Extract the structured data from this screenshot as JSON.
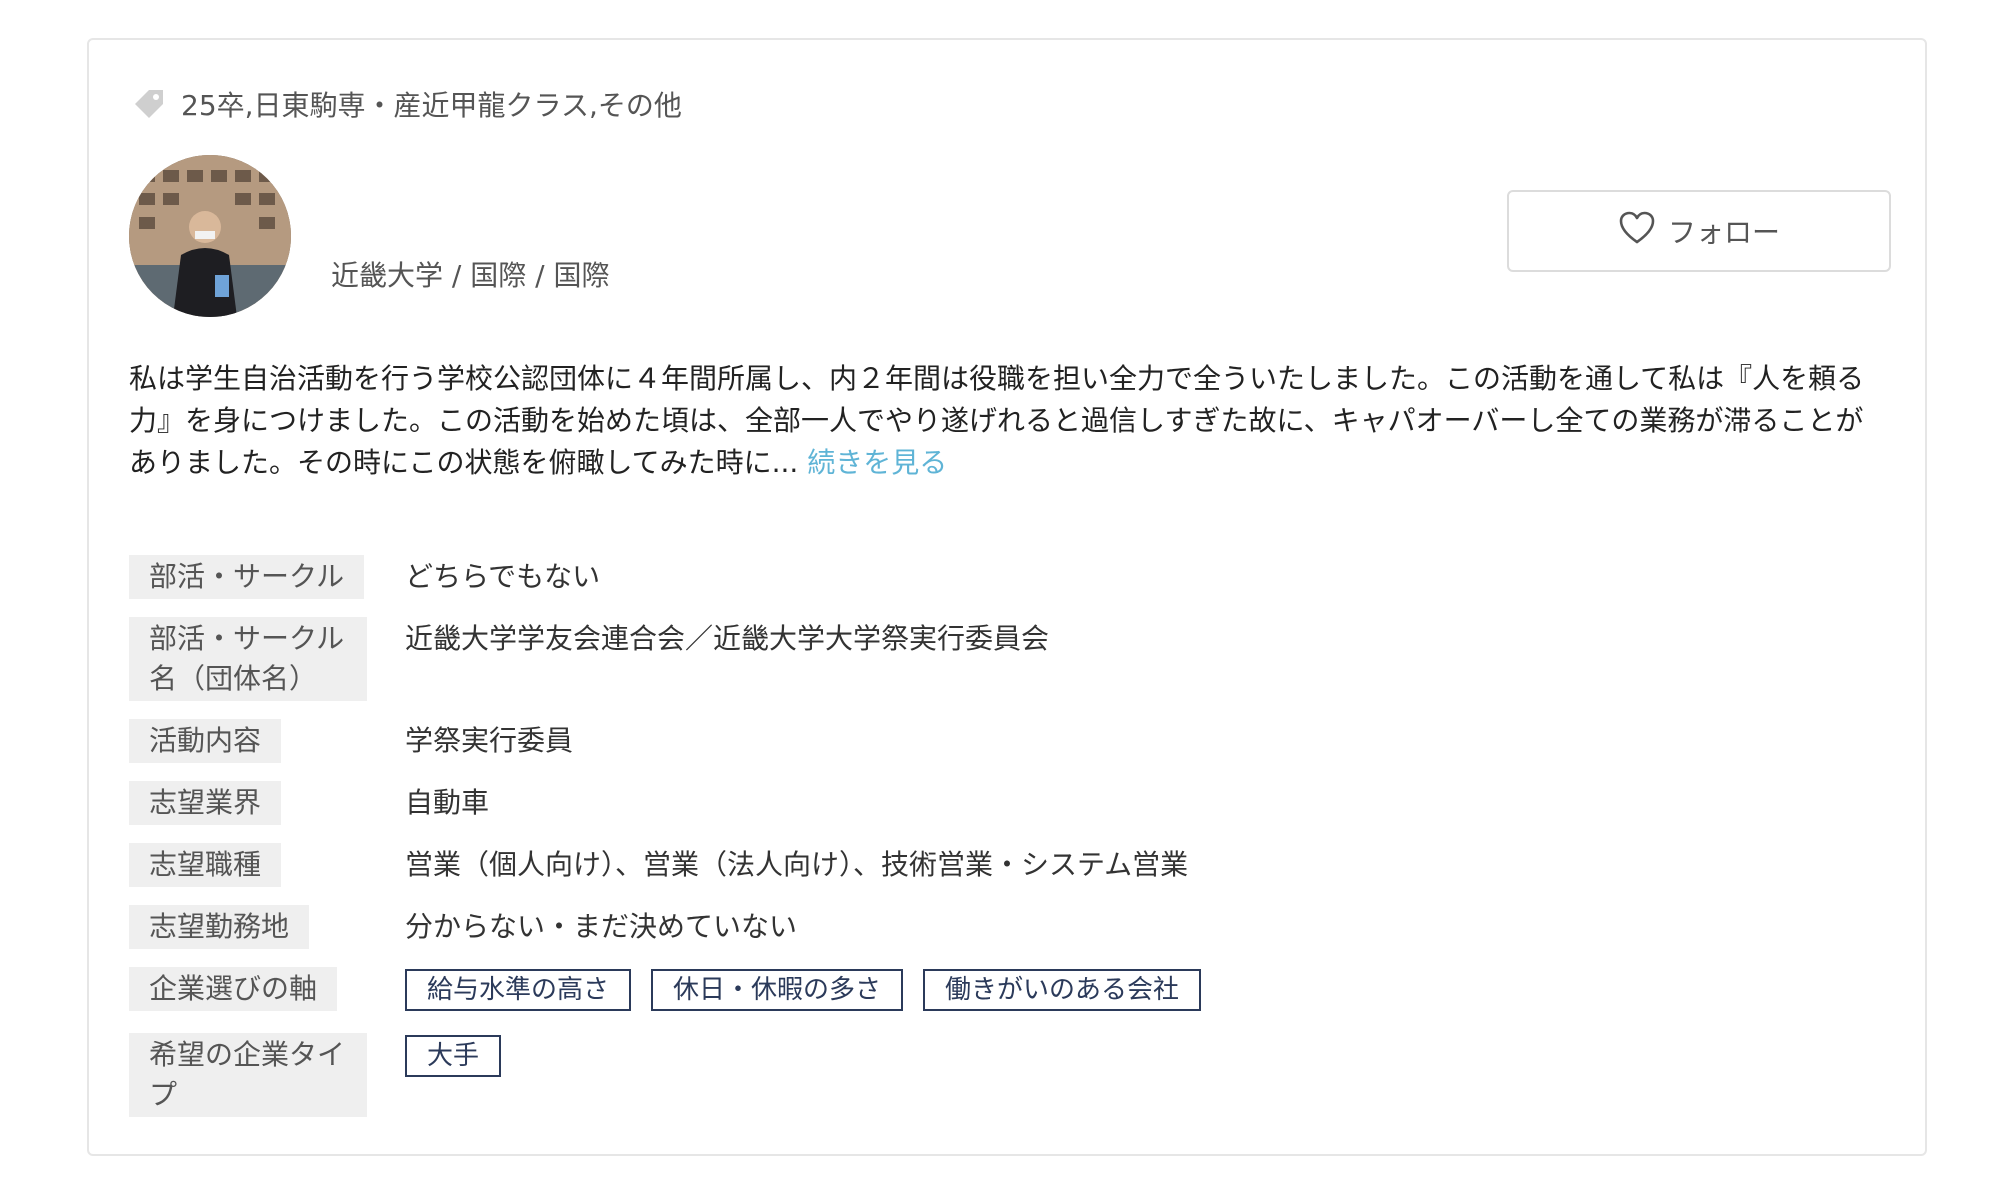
{
  "tags_text": "25卒,日東駒専・産近甲龍クラス,その他",
  "profile": {
    "school": "近畿大学 / 国際 / 国際"
  },
  "follow": {
    "label": "フォロー"
  },
  "intro": {
    "text": "私は学生自治活動を行う学校公認団体に４年間所属し、内２年間は役職を担い全力で全ういたしました。この活動を通して私は『人を頼る力』を身につけました。この活動を始めた頃は、全部一人でやり遂げれると過信しすぎた故に、キャパオーバーし全ての業務が滞ることがありました。その時にこの状態を俯瞰してみた時に...",
    "read_more": "続きを見る"
  },
  "rows": [
    {
      "label": "部活・サークル",
      "value": "どちらでもない"
    },
    {
      "label": "部活・サークル名（団体名）",
      "value": "近畿大学学友会連合会／近畿大学大学祭実行委員会"
    },
    {
      "label": "活動内容",
      "value": "学祭実行委員"
    },
    {
      "label": "志望業界",
      "value": "自動車"
    },
    {
      "label": "志望職種",
      "value": "営業（個人向け）、営業（法人向け）、技術営業・システム営業"
    },
    {
      "label": "志望勤務地",
      "value": "分からない・まだ決めていない"
    },
    {
      "label": "企業選びの軸",
      "chips": [
        "給与水準の高さ",
        "休日・休暇の多さ",
        "働きがいのある会社"
      ]
    },
    {
      "label": "希望の企業タイプ",
      "chips": [
        "大手"
      ]
    }
  ],
  "colors": {
    "accent_link": "#5fb4d6",
    "chip_border": "#2b3a5a",
    "label_bg": "#efefef"
  },
  "icons": {
    "tag": "tag-icon",
    "follow": "heart-outline-icon"
  }
}
